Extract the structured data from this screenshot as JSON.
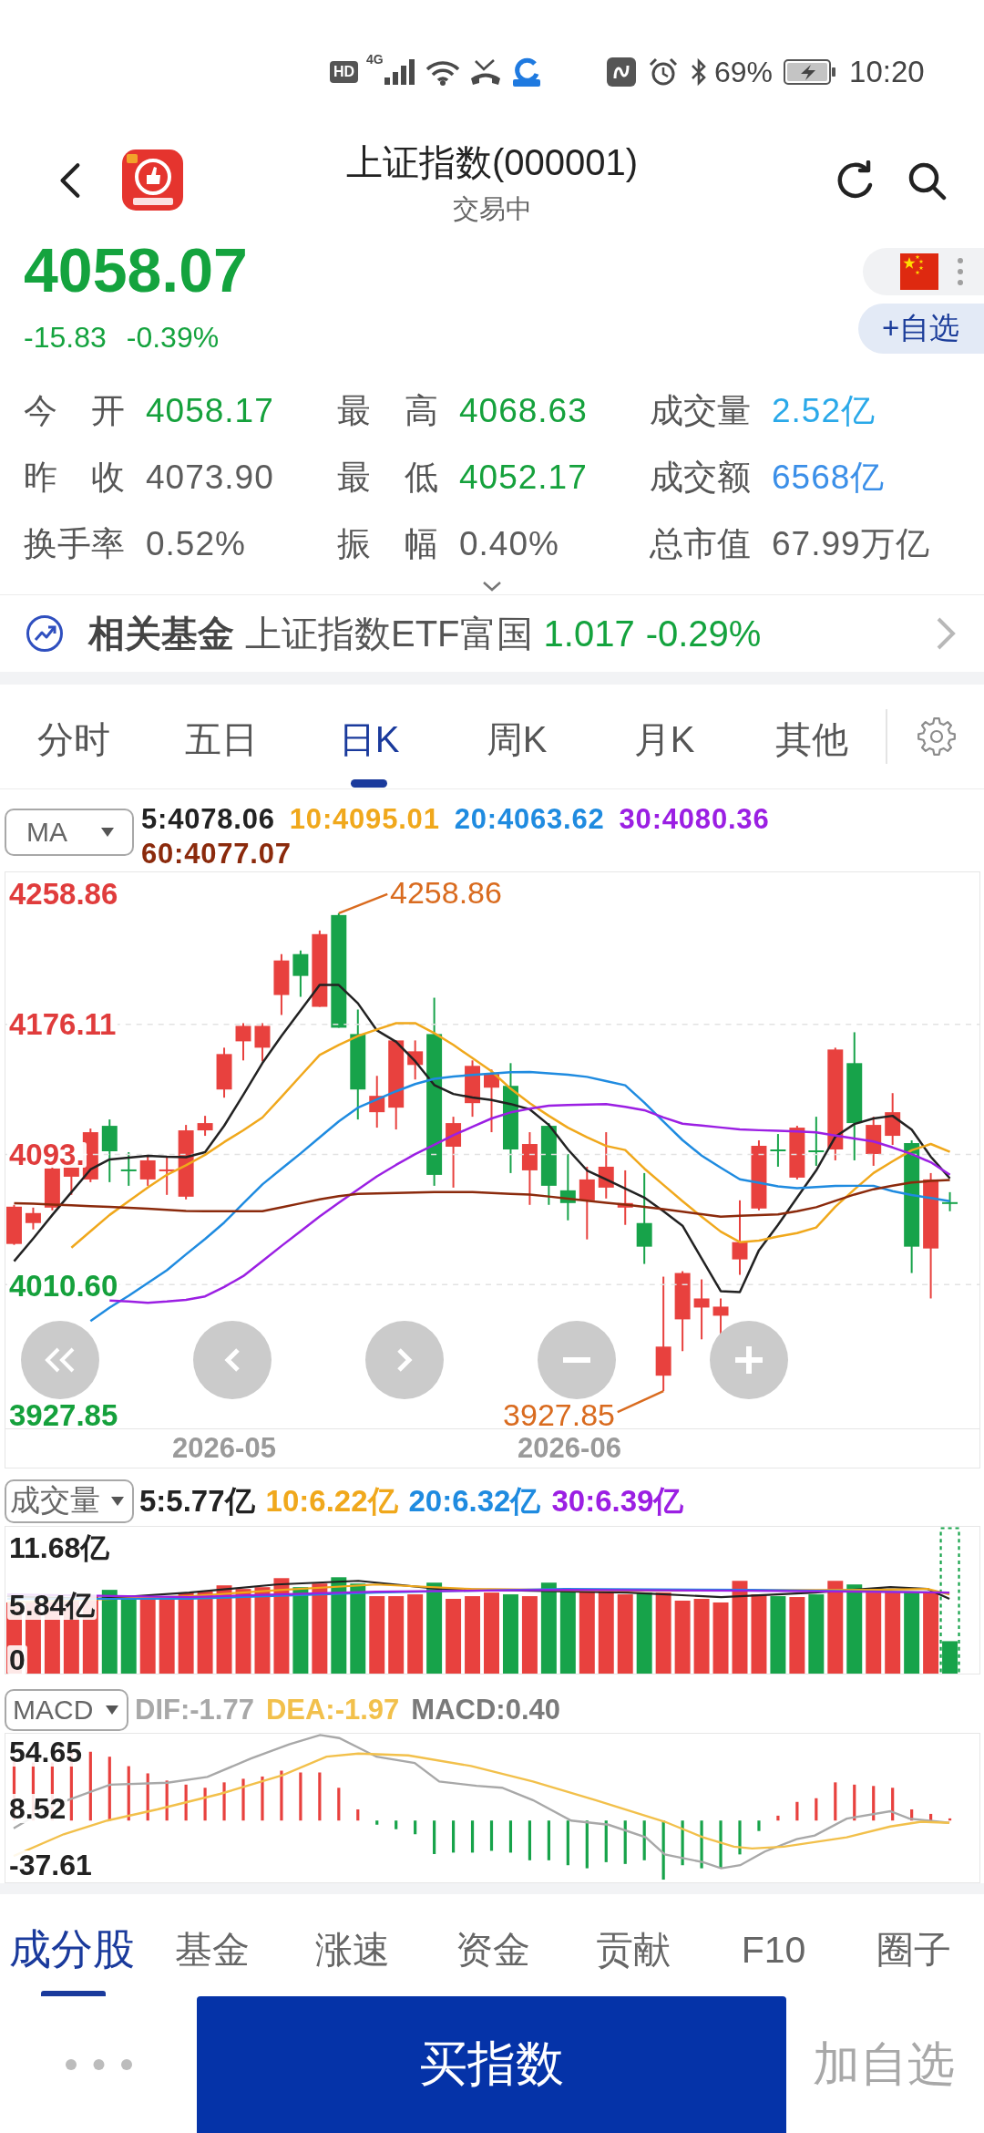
{
  "status_bar": {
    "hd_label": "HD",
    "network_label": "4G",
    "battery": "69%",
    "time": "10:20"
  },
  "header": {
    "title": "上证指数(000001)",
    "subtitle": "交易中"
  },
  "quote": {
    "price": "4058.07",
    "change": "-15.83",
    "change_percent": "-0.39%",
    "watch_button": "+自选"
  },
  "stats": [
    {
      "label": "今开",
      "value": "4058.17",
      "color": "#15a13c"
    },
    {
      "label": "最高",
      "value": "4068.63",
      "color": "#15a13c"
    },
    {
      "label": "成交量",
      "value": "2.52亿",
      "color": "#2aa9e9"
    },
    {
      "label": "昨收",
      "value": "4073.90",
      "color": "#5c5c5c"
    },
    {
      "label": "最低",
      "value": "4052.17",
      "color": "#15a13c"
    },
    {
      "label": "成交额",
      "value": "6568亿",
      "color": "#3b8fe8"
    },
    {
      "label": "换手率",
      "value": "0.52%",
      "color": "#5c5c5c"
    },
    {
      "label": "振幅",
      "value": "0.40%",
      "color": "#5c5c5c"
    },
    {
      "label": "总市值",
      "value": "67.99万亿",
      "color": "#5c5c5c"
    }
  ],
  "related_fund": {
    "label": "相关基金",
    "name": "上证指数ETF富国",
    "price": "1.017",
    "change": "-0.29%"
  },
  "period_tabs": [
    {
      "label": "分时",
      "selected": false
    },
    {
      "label": "五日",
      "selected": false
    },
    {
      "label": "日K",
      "selected": true
    },
    {
      "label": "周K",
      "selected": false
    },
    {
      "label": "月K",
      "selected": false
    },
    {
      "label": "其他",
      "selected": false
    }
  ],
  "kline": {
    "indicator": "MA",
    "legend": [
      {
        "text": "5:4078.06",
        "color": "#222222"
      },
      {
        "text": "10:4095.01",
        "color": "#f0a81c"
      },
      {
        "text": "20:4063.62",
        "color": "#1f8be0"
      },
      {
        "text": "30:4080.36",
        "color": "#9b1fe3"
      },
      {
        "text": "60:4077.07",
        "color": "#8b2a0c"
      }
    ],
    "y_labels": [
      {
        "color": "#e03c3c"
      },
      {
        "color": "#e03c3c"
      },
      {
        "color": "#e03c3c"
      },
      {
        "color": "#15a13c"
      },
      {
        "color": "#15a13c"
      }
    ],
    "high_label": "4258.86",
    "low_label": "3927.85",
    "dates": [
      "2026-05",
      "2026-06"
    ],
    "chart_data": {
      "type": "line",
      "grid": true,
      "ylim": [
        3919.18,
        4272.72
      ],
      "yticks": [
        {
          "value": 4258.86,
          "label": "4258.86"
        },
        {
          "value": 4176.11,
          "label": "4176.11"
        },
        {
          "value": 4093.36,
          "label": "4093."
        },
        {
          "value": 4010.6,
          "label": "4010.60"
        },
        {
          "value": 3927.85,
          "label": "3927.85"
        }
      ],
      "series": [
        {
          "color": "#222222",
          "values": [
            4025.5,
            4039.9,
            4054.9,
            4069.4,
            4083.8,
            4090.2,
            4091.3,
            4092.5,
            4091.9,
            4091.6,
            4094.8,
            4111.6,
            4131.2,
            4151.4,
            4168.7,
            4184.9,
            4201.1,
            4201.1,
            4189.5,
            4172.2,
            4165.0,
            4152.6,
            4137.5,
            4131.8,
            4129.5,
            4128.0,
            4125.4,
            4122.0,
            4112.1,
            4096.5,
            4083.2,
            4077.5,
            4071.7,
            4065.9,
            4057.3,
            4048.0,
            4027.2,
            4006.4,
            4005.8,
            4032.4,
            4048.6,
            4065.9,
            4083.2,
            4104.6,
            4112.7,
            4116.2,
            4117.9,
            4109.2,
            4091.9,
            4078.1
          ]
        },
        {
          "color": "#f0a81c",
          "values": [
            null,
            null,
            null,
            4034.1,
            4044.5,
            4054.9,
            4063.6,
            4072.3,
            4080.4,
            4086.4,
            4093.1,
            4101.2,
            4108.7,
            4116.8,
            4130.0,
            4143.3,
            4156.6,
            4163.0,
            4168.7,
            4172.8,
            4176.8,
            4176.8,
            4170.5,
            4163.0,
            4154.6,
            4146.2,
            4135.2,
            4126.0,
            4117.9,
            4110.4,
            4104.3,
            4098.8,
            4096.2,
            4084.4,
            4074.0,
            4063.6,
            4053.8,
            4044.3,
            4037.6,
            4038.5,
            4041.1,
            4043.4,
            4046.9,
            4060.1,
            4071.1,
            4081.5,
            4089.0,
            4096.0,
            4100.0,
            4095.0
          ]
        },
        {
          "color": "#1f8be0",
          "values": [
            null,
            null,
            null,
            null,
            3987.4,
            3996.0,
            4003.5,
            4011.6,
            4019.7,
            4029.8,
            4039.6,
            4050.0,
            4062.2,
            4074.3,
            4084.2,
            4094.0,
            4104.2,
            4114.4,
            4123.1,
            4128.3,
            4133.5,
            4138.1,
            4141.4,
            4142.9,
            4143.9,
            4144.8,
            4145.7,
            4145.8,
            4144.9,
            4144.0,
            4142.7,
            4140.0,
            4137.3,
            4126.3,
            4114.3,
            4102.5,
            4092.6,
            4085.0,
            4077.6,
            4075.3,
            4073.1,
            4071.9,
            4072.6,
            4073.3,
            4073.4,
            4073.4,
            4070.0,
            4067.6,
            4065.6,
            4063.6
          ]
        },
        {
          "color": "#9b1fe3",
          "values": [
            null,
            null,
            null,
            null,
            null,
            4000.5,
            3999.8,
            3999.0,
            3999.8,
            4000.9,
            4003.1,
            4009.1,
            4016.0,
            4025.6,
            4035.2,
            4044.5,
            4053.9,
            4062.6,
            4071.0,
            4079.4,
            4086.7,
            4093.5,
            4099.5,
            4105.6,
            4110.9,
            4116.2,
            4120.1,
            4122.4,
            4124.3,
            4124.7,
            4125.0,
            4125.4,
            4123.6,
            4121.5,
            4116.9,
            4112.9,
            4111.7,
            4110.5,
            4109.3,
            4108.8,
            4108.4,
            4107.9,
            4107.4,
            4105.4,
            4103.5,
            4101.6,
            4097.8,
            4093.5,
            4088.4,
            4080.4
          ]
        },
        {
          "color": "#8b2a0c",
          "values": [
            4062.4,
            4062.0,
            4061.5,
            4061.0,
            4060.5,
            4060.0,
            4059.5,
            4058.8,
            4058.1,
            4057.4,
            4057.3,
            4057.3,
            4057.3,
            4057.3,
            4059.7,
            4062.3,
            4064.8,
            4066.8,
            4068.3,
            4068.6,
            4068.9,
            4069.2,
            4069.4,
            4069.4,
            4069.4,
            4068.9,
            4068.3,
            4067.8,
            4066.6,
            4065.2,
            4063.9,
            4062.6,
            4061.4,
            4060.1,
            4058.6,
            4057.0,
            4055.4,
            4053.8,
            4054.3,
            4054.8,
            4055.3,
            4057.3,
            4059.8,
            4063.9,
            4067.9,
            4071.2,
            4073.5,
            4075.5,
            4076.5,
            4077.1
          ]
        }
      ]
    }
  },
  "volume": {
    "indicator": "成交量",
    "legend": [
      {
        "text": "5:5.77亿",
        "color": "#222222"
      },
      {
        "text": "10:6.22亿",
        "color": "#f0a81c"
      },
      {
        "text": "20:6.32亿",
        "color": "#1f8be0"
      },
      {
        "text": "30:6.39亿",
        "color": "#9b1fe3"
      }
    ],
    "y_labels": [
      "11.68亿",
      "5.84亿",
      "0"
    ]
  },
  "macd": {
    "indicator": "MACD",
    "legend": [
      {
        "text": "DIF:-1.77",
        "color": "#a8a8a8"
      },
      {
        "text": "DEA:-1.97",
        "color": "#f2c04b"
      },
      {
        "text": "MACD:0.40",
        "color": "#7a7a7a"
      }
    ],
    "y_labels": [
      "54.65",
      "8.52",
      "-37.61"
    ]
  },
  "bottom_tabs": [
    {
      "label": "成分股",
      "selected": true
    },
    {
      "label": "基金",
      "selected": false
    },
    {
      "label": "涨速",
      "selected": false
    },
    {
      "label": "资金",
      "selected": false
    },
    {
      "label": "贡献",
      "selected": false
    },
    {
      "label": "F10",
      "selected": false
    },
    {
      "label": "圈子",
      "selected": false
    }
  ],
  "actions": {
    "buy_button": "买指数",
    "watch_button": "加自选"
  }
}
